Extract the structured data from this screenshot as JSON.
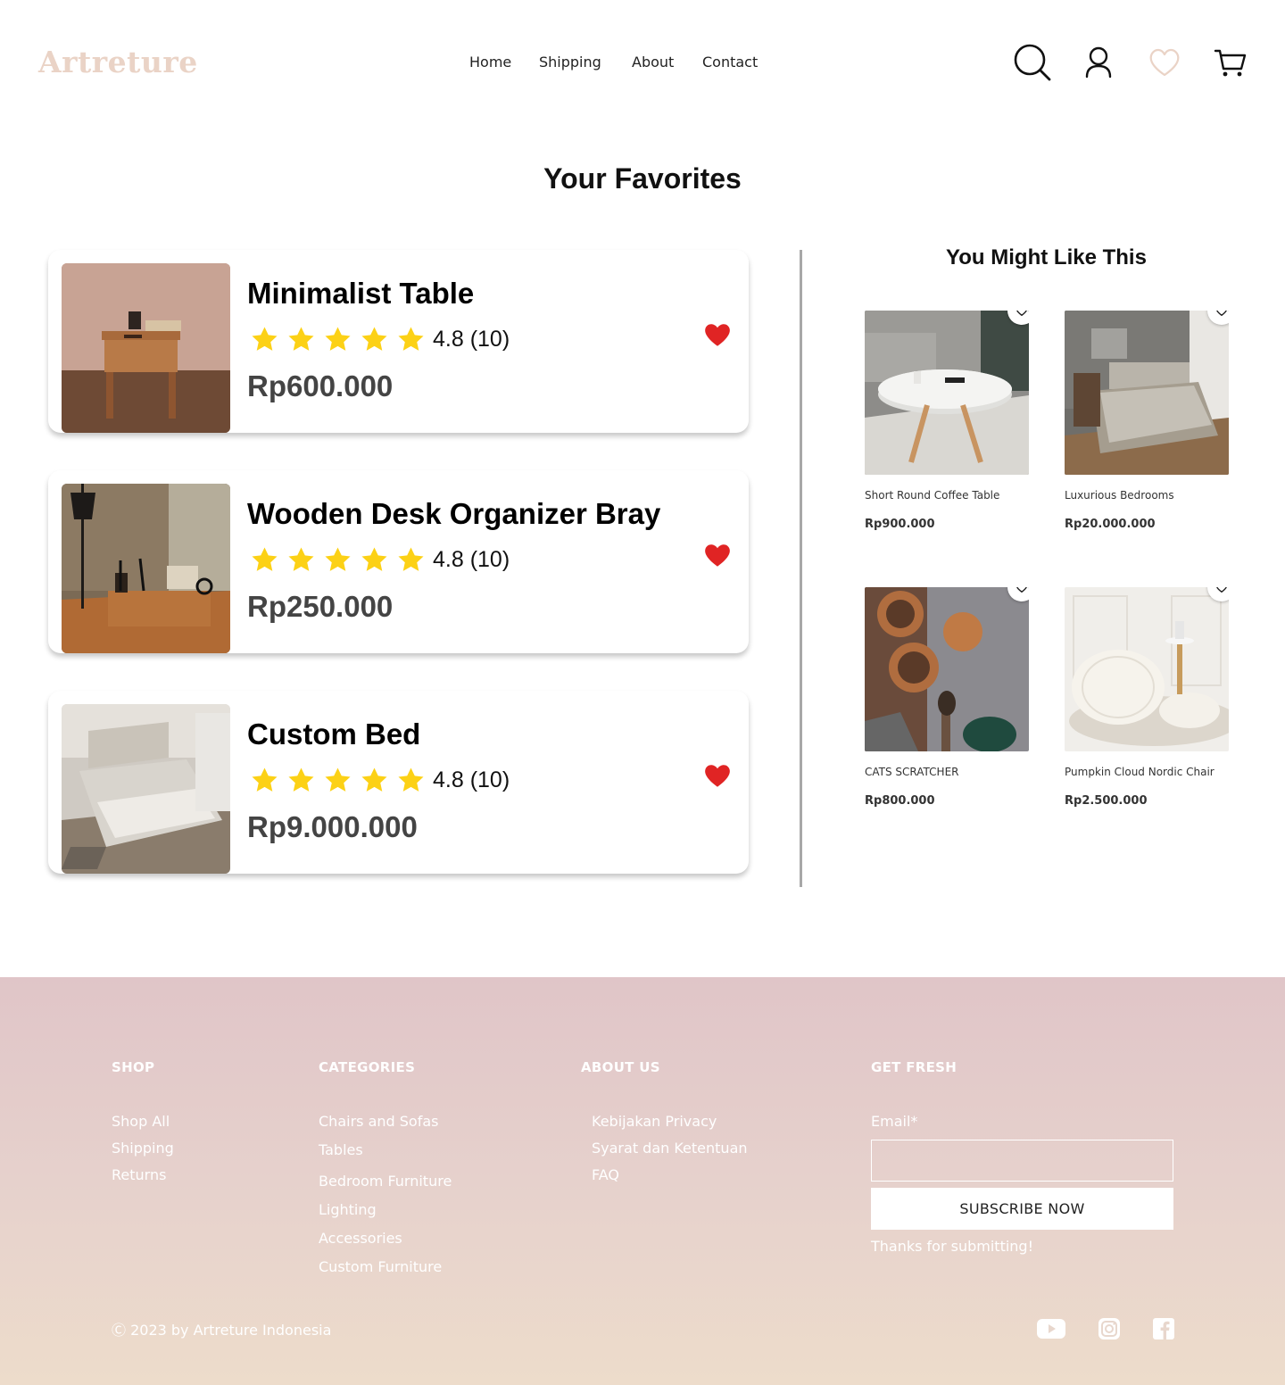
{
  "brand": {
    "logo": "Artreture",
    "color": "#ead3c6"
  },
  "nav": {
    "home": "Home",
    "shipping": "Shipping",
    "about": "About",
    "contact": "Contact"
  },
  "header_icons": [
    "search-icon",
    "user-icon",
    "heart-icon",
    "cart-icon"
  ],
  "page_title": "Your Favorites",
  "favorites": [
    {
      "name": "Minimalist Table",
      "rating": "4.8 (10)",
      "stars": 5,
      "price": "Rp600.000"
    },
    {
      "name": "Wooden Desk Organizer Bray",
      "rating": "4.8 (10)",
      "stars": 5,
      "price": "Rp250.000"
    },
    {
      "name": "Custom Bed",
      "rating": "4.8 (10)",
      "stars": 5,
      "price": "Rp9.000.000"
    }
  ],
  "recommend": {
    "title": "You Might Like This",
    "items": [
      {
        "name": "Short Round Coffee Table",
        "price": "Rp900.000"
      },
      {
        "name": "Luxurious Bedrooms",
        "price": "Rp20.000.000"
      },
      {
        "name": "CATS SCRATCHER",
        "price": "Rp800.000"
      },
      {
        "name": "Pumpkin Cloud Nordic Chair",
        "price": "Rp2.500.000"
      }
    ]
  },
  "footer": {
    "shop": {
      "title": "SHOP",
      "links": [
        "Shop All",
        "Shipping",
        "Returns"
      ]
    },
    "categories": {
      "title": "CATEGORIES",
      "links": [
        "Chairs and Sofas",
        "Tables",
        "Bedroom Furniture",
        "Lighting",
        "Accessories",
        "Custom Furniture"
      ]
    },
    "about": {
      "title": "ABOUT US",
      "links": [
        "Kebijakan Privacy",
        "Syarat dan Ketentuan",
        "FAQ"
      ]
    },
    "fresh": {
      "title": "GET FRESH",
      "email_label": "Email*",
      "email_value": "",
      "button": "SUBSCRIBE NOW",
      "thanks": "Thanks for submitting!"
    },
    "copyright": "Ⓒ 2023 by Artreture Indonesia",
    "social": [
      "youtube-icon",
      "instagram-icon",
      "facebook-icon"
    ]
  },
  "colors": {
    "star": "#fcd116",
    "heart": "#e02424",
    "divider": "#a8a8a8",
    "footer_top": "#e0c5c8",
    "footer_bottom": "#eddccb"
  }
}
